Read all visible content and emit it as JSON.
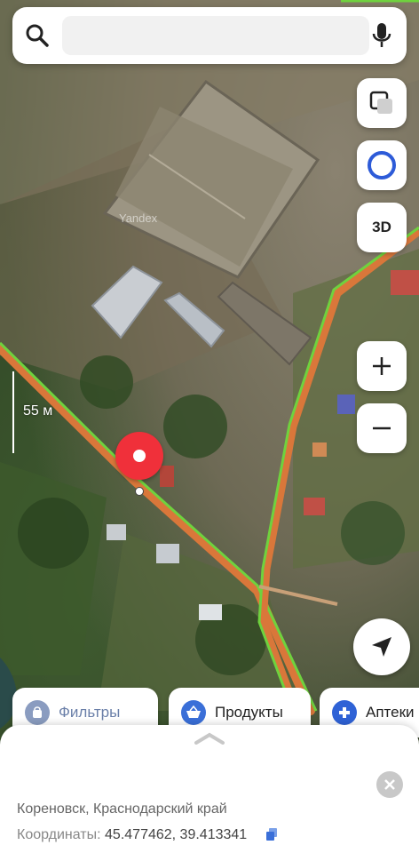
{
  "search": {
    "value": "",
    "placeholder": ""
  },
  "icons": {
    "search": "search-icon",
    "mic": "microphone-icon",
    "layers": "layers-icon",
    "assistant": "alice-icon",
    "zoom_in": "plus-icon",
    "zoom_out": "minus-icon",
    "locate": "navigation-arrow-icon",
    "close": "close-icon",
    "copy": "copy-icon"
  },
  "controls": {
    "three_d_label": "3D"
  },
  "scale": {
    "label": "55 м"
  },
  "watermark": "Yandex",
  "chips": [
    {
      "label": "Фильтры",
      "icon": "shopping-bag-icon",
      "color": "#6a7fa8"
    },
    {
      "label": "Продукты",
      "icon": "basket-icon",
      "color": "#3a6fd8"
    },
    {
      "label": "Аптеки",
      "icon": "pharmacy-cross-icon",
      "color": "#2f62d6"
    }
  ],
  "sheet": {
    "address": "Кореновск, Краснодарский край",
    "coords_label": "Координаты:",
    "coords_value": "45.477462, 39.413341"
  },
  "colors": {
    "pin": "#f0303a",
    "road_traffic": "#6fd23e",
    "road_base": "#d9773a",
    "accent": "#2f62d6"
  }
}
